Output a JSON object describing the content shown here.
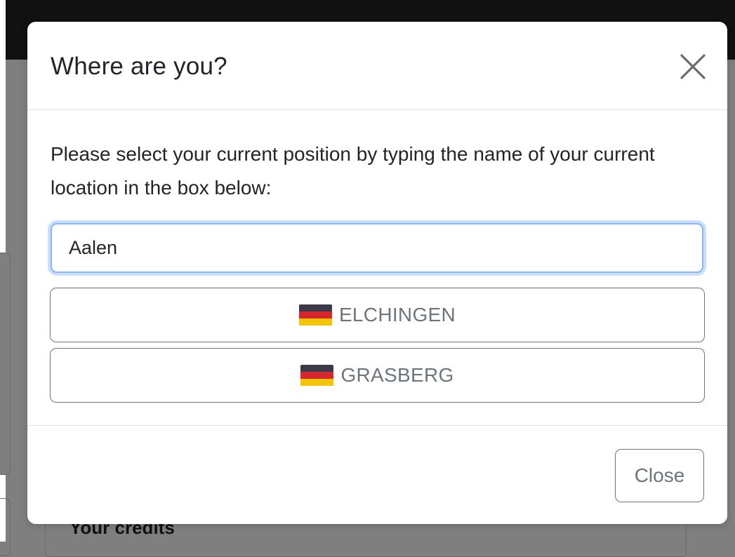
{
  "background": {
    "card_title": "Your credits"
  },
  "modal": {
    "title": "Where are you?",
    "close_icon": "close-x-icon",
    "body_text": "Please select your current position by typing the name of your current location in the box below:",
    "search": {
      "value": "Aalen"
    },
    "results": [
      {
        "flag": "germany-flag-icon",
        "label": "ELCHINGEN"
      },
      {
        "flag": "germany-flag-icon",
        "label": "GRASBERG"
      }
    ],
    "footer": {
      "close_label": "Close"
    }
  },
  "colors": {
    "focus_border": "#86b7fe",
    "secondary": "#6c757d",
    "flag_black": "#3a3a48",
    "flag_red": "#d7262e",
    "flag_gold": "#f5c400"
  }
}
